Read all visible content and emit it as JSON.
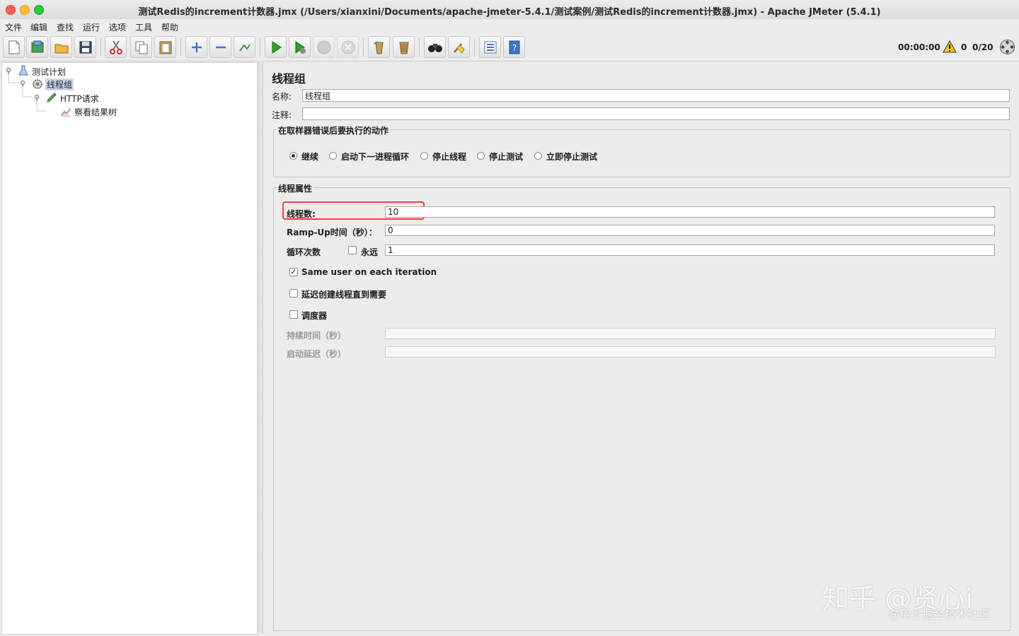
{
  "window": {
    "title": "测试Redis的increment计数器.jmx (/Users/xianxini/Documents/apache-jmeter-5.4.1/测试案例/测试Redis的increment计数器.jmx) - Apache JMeter (5.4.1)"
  },
  "menu": [
    "文件",
    "编辑",
    "查找",
    "运行",
    "选项",
    "工具",
    "帮助"
  ],
  "toolbar": {
    "icons": [
      "new-icon",
      "templates-icon",
      "open-icon",
      "save-icon",
      "cut-icon",
      "copy-icon",
      "paste-icon",
      "expand-icon",
      "collapse-icon",
      "toggle-icon",
      "start-icon",
      "start-no-pause-icon",
      "stop-icon",
      "shutdown-icon",
      "clear-icon",
      "clear-all-icon",
      "search-icon",
      "reset-search-icon",
      "function-helper-icon",
      "help-icon"
    ],
    "timer": "00:00:00",
    "warnings": "0",
    "threads": "0/20"
  },
  "tree": {
    "plan": "测试计划",
    "thread_group": "线程组",
    "http": "HTTP请求",
    "listener": "察看结果树"
  },
  "panel": {
    "title": "线程组",
    "name_label": "名称:",
    "name_value": "线程组",
    "comment_label": "注释:",
    "comment_value": "",
    "error_group": {
      "title": "在取样器错误后要执行的动作",
      "options": [
        "继续",
        "启动下一进程循环",
        "停止线程",
        "停止测试",
        "立即停止测试"
      ],
      "selected": "继续"
    },
    "props": {
      "title": "线程属性",
      "threads_label": "线程数:",
      "threads_value": "10",
      "rampup_label": "Ramp-Up时间（秒）：",
      "rampup_value": "0",
      "loop_label": "循环次数",
      "forever_label": "永远",
      "loop_value": "1",
      "same_user_label": "Same user on each iteration",
      "delay_label": "延迟创建线程直到需要",
      "scheduler_label": "调度器",
      "duration_label": "持续时间（秒）",
      "duration_value": "",
      "startup_label": "启动延迟（秒）",
      "startup_value": ""
    }
  },
  "watermark": {
    "main": "知乎 @贤心i",
    "sub": "@稀土掘金技术社区"
  },
  "colors": {
    "highlight_box": "#e8453c",
    "selection": "#c7d8ee"
  }
}
